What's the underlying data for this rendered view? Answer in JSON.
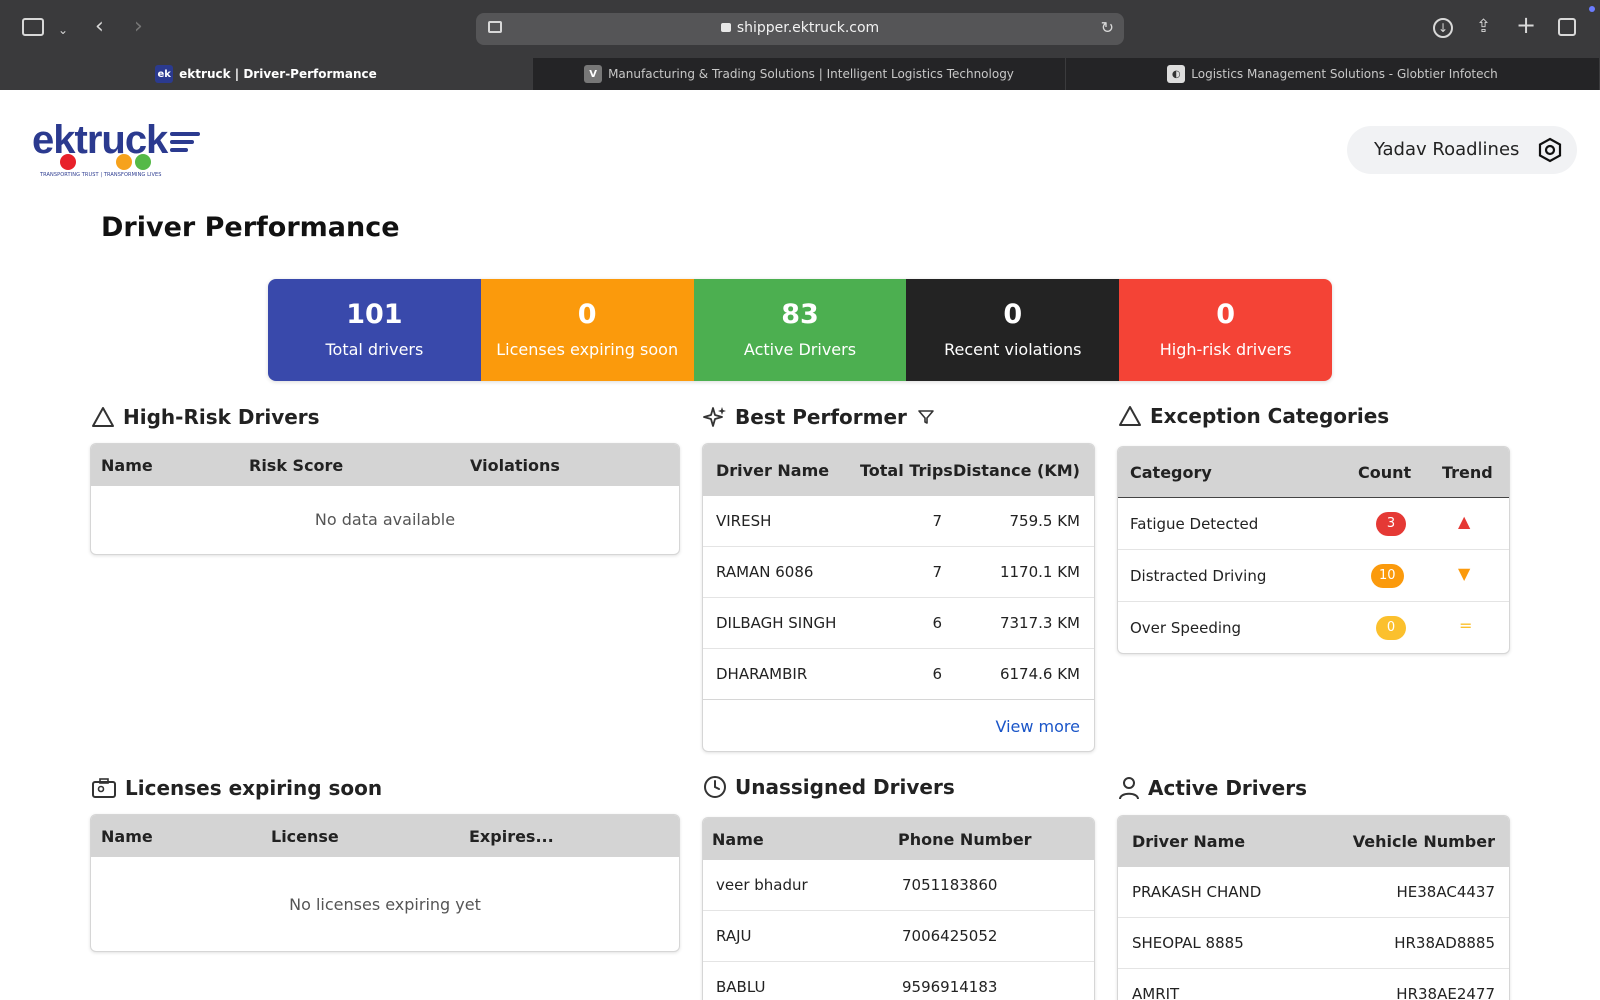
{
  "browser": {
    "url": "shipper.ektruck.com",
    "tabs": [
      {
        "label": "ektruck | Driver-Performance",
        "favicon": "ek",
        "favicon_color": "#2b3a8f"
      },
      {
        "label": "Manufacturing & Trading Solutions | Intelligent Logistics Technology",
        "favicon": "V",
        "favicon_color": "#777"
      },
      {
        "label": "Logistics Management Solutions - Globtier Infotech",
        "favicon": "",
        "favicon_color": "#ddd"
      }
    ]
  },
  "header": {
    "logo_text": "ektruck",
    "logo_tagline": "TRANSPORTING TRUST | TRANSFORMING LIVES",
    "company": "Yadav Roadlines"
  },
  "page_title": "Driver Performance",
  "stats": [
    {
      "value": "101",
      "label": "Total drivers",
      "color": "#3949ab"
    },
    {
      "value": "0",
      "label": "Licenses expiring soon",
      "color": "#fb9a0c"
    },
    {
      "value": "83",
      "label": "Active Drivers",
      "color": "#4caf50"
    },
    {
      "value": "0",
      "label": "Recent violations",
      "color": "#232323"
    },
    {
      "value": "0",
      "label": "High-risk drivers",
      "color": "#f44336"
    }
  ],
  "high_risk": {
    "title": "High-Risk Drivers",
    "columns": [
      "Name",
      "Risk Score",
      "Violations"
    ],
    "empty": "No data available"
  },
  "best_performer": {
    "title": "Best Performer",
    "columns": [
      "Driver Name",
      "Total Trips",
      "Distance (KM)"
    ],
    "rows": [
      [
        "VIRESH",
        "7",
        "759.5 KM"
      ],
      [
        "RAMAN 6086",
        "7",
        "1170.1 KM"
      ],
      [
        "DILBAGH SINGH",
        "6",
        "7317.3 KM"
      ],
      [
        "DHARAMBIR",
        "6",
        "6174.6 KM"
      ]
    ],
    "view_more": "View more"
  },
  "exceptions": {
    "title": "Exception Categories",
    "columns": [
      "Category",
      "Count",
      "Trend"
    ],
    "rows": [
      {
        "category": "Fatigue Detected",
        "count": "3",
        "badge_color": "#e53935",
        "trend": "▲",
        "trend_color": "#e53935"
      },
      {
        "category": "Distracted Driving",
        "count": "10",
        "badge_color": "#fb9a0c",
        "trend": "▼",
        "trend_color": "#fb9a0c"
      },
      {
        "category": "Over Speeding",
        "count": "0",
        "badge_color": "#fbc02d",
        "trend": "=",
        "trend_color": "#fbc02d"
      }
    ]
  },
  "licenses": {
    "title": "Licenses expiring soon",
    "columns": [
      "Name",
      "License",
      "Expires..."
    ],
    "empty": "No licenses expiring yet"
  },
  "unassigned": {
    "title": "Unassigned Drivers",
    "columns": [
      "Name",
      "Phone Number"
    ],
    "rows": [
      [
        "veer bhadur",
        "7051183860"
      ],
      [
        "RAJU",
        "7006425052"
      ],
      [
        "BABLU",
        "9596914183"
      ]
    ]
  },
  "active": {
    "title": "Active Drivers",
    "columns": [
      "Driver Name",
      "Vehicle Number"
    ],
    "rows": [
      [
        "PRAKASH CHAND",
        "HE38AC4437"
      ],
      [
        "SHEOPAL 8885",
        "HR38AD8885"
      ],
      [
        "AMRIT",
        "HR38AE2477"
      ]
    ]
  }
}
